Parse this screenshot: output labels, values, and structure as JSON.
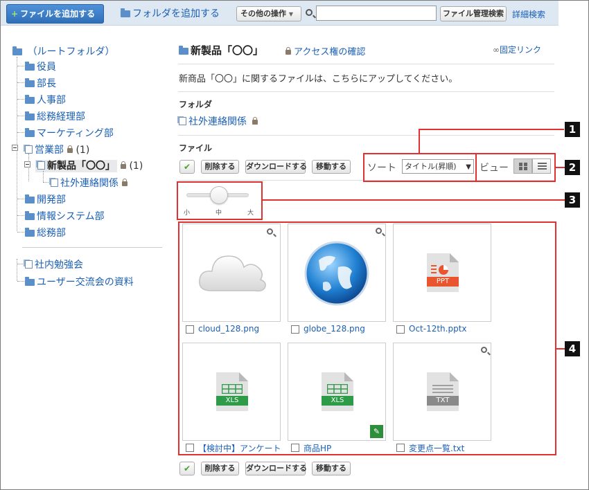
{
  "toolbar": {
    "add_file": "ファイルを追加する",
    "add_folder": "フォルダを追加する",
    "other_ops": "その他の操作",
    "search_value": "",
    "file_search": "ファイル管理検索",
    "detail_search": "詳細検索"
  },
  "tree": {
    "root": "（ルートフォルダ）",
    "items": [
      "役員",
      "部長",
      "人事部",
      "総務経理部",
      "マーケティング部"
    ],
    "sales": "営業部",
    "sales_count": "(1)",
    "current": "新製品「〇〇」",
    "current_count": "(1)",
    "child": "社外連絡関係",
    "items2": [
      "開発部",
      "情報システム部",
      "総務部"
    ],
    "extra": [
      "社内勉強会",
      "ユーザー交流会の資料"
    ]
  },
  "main": {
    "title": "新製品「〇〇」",
    "access_check": "アクセス権の確認",
    "permalink": "固定リンク",
    "description": "新商品「〇〇」に関するファイルは、こちらにアップしてください。",
    "folder_heading": "フォルダ",
    "subfolder": "社外連絡関係",
    "file_heading": "ファイル",
    "check_glyph": "✔",
    "delete": "削除する",
    "download": "ダウンロードする",
    "move": "移動する",
    "sort_label": "ソート",
    "sort_value": "タイトル(昇順)",
    "view_label": "ビュー",
    "slider": {
      "small": "小",
      "medium": "中",
      "large": "大",
      "level": 0.5
    }
  },
  "files": [
    {
      "name": "cloud_128.png",
      "icon": "cloud-thumbnail"
    },
    {
      "name": "globe_128.png",
      "icon": "globe-thumbnail"
    },
    {
      "name": "Oct-12th.pptx",
      "icon": "ppt-file-icon",
      "tag": "PPT"
    },
    {
      "name": "【検討中】アンケート",
      "icon": "xls-file-icon",
      "tag": "XLS"
    },
    {
      "name": "商品HP",
      "icon": "xls-file-icon",
      "tag": "XLS"
    },
    {
      "name": "変更点一覧.txt",
      "icon": "txt-file-icon",
      "tag": "TXT"
    }
  ],
  "callouts": [
    "1",
    "2",
    "3",
    "4"
  ],
  "colors": {
    "accent": "#1a5fb4",
    "callout": "#e0302f",
    "ppt": "#e8552f",
    "xls": "#2e9b48",
    "txt": "#8a8a8a"
  }
}
